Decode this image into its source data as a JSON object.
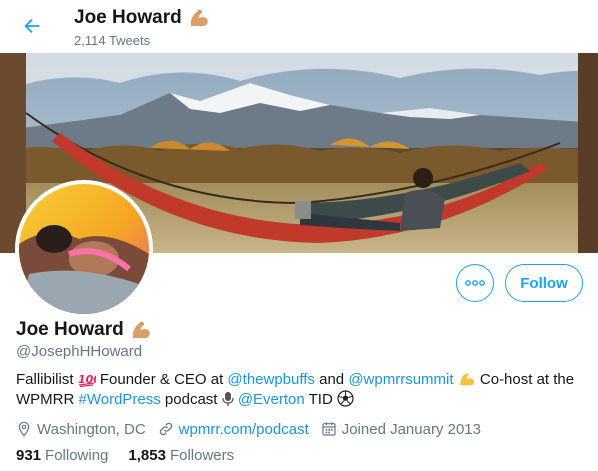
{
  "header": {
    "name": "Joe Howard",
    "tweet_count": "2,114 Tweets"
  },
  "profile": {
    "name": "Joe Howard",
    "handle": "@JosephHHoward",
    "follow_label": "Follow"
  },
  "bio": {
    "t1": "Fallibilist ",
    "t2": " Founder & CEO at ",
    "link1": "@thewpbuffs",
    "t3": " and ",
    "link2": "@wpmrrsummit",
    "t4": " Co-host at the WPMRR ",
    "link3": "#WordPress",
    "t5": " podcast ",
    "link4": "@Everton",
    "t6": " TID "
  },
  "meta": {
    "location": "Washington, DC",
    "website": "wpmrr.com/podcast",
    "joined": "Joined January 2013"
  },
  "stats": {
    "following_count": "931",
    "following_label": "Following",
    "followers_count": "1,853",
    "followers_label": "Followers"
  },
  "colors": {
    "accent": "#1da1f2",
    "link": "#1b95e0",
    "muted": "#657786"
  },
  "icons": {
    "back": "arrow-left-icon",
    "more": "more-dots-icon",
    "location": "map-pin-icon",
    "website": "link-icon",
    "joined": "calendar-icon",
    "flex": "flexed-biceps-emoji",
    "hundred": "hundred-points-emoji",
    "mic": "microphone-emoji",
    "ball": "soccer-ball-emoji"
  }
}
